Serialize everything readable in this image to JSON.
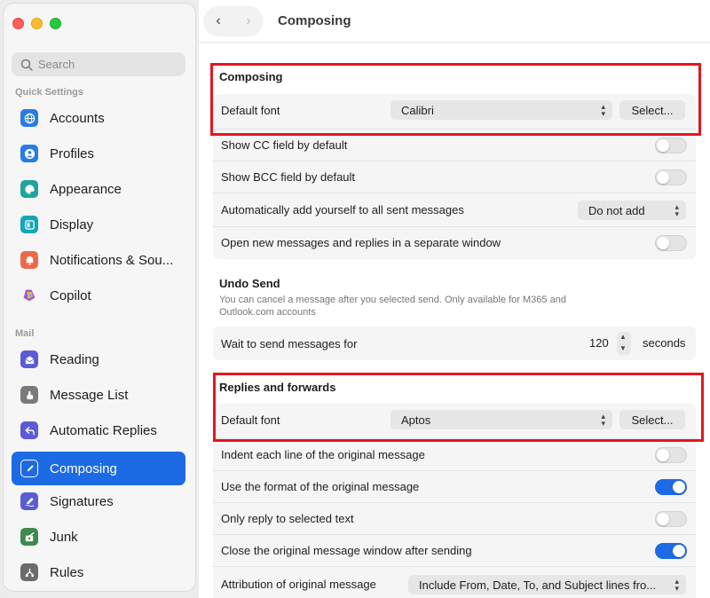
{
  "sidebar": {
    "search_placeholder": "Search",
    "section_quick": "Quick Settings",
    "section_mail": "Mail",
    "items": [
      {
        "label": "Accounts",
        "icon": "globe-icon",
        "color": "#2a7be4"
      },
      {
        "label": "Profiles",
        "icon": "person-icon",
        "color": "#2a7be4"
      },
      {
        "label": "Appearance",
        "icon": "palette-icon",
        "color": "#1fa59a"
      },
      {
        "label": "Display",
        "icon": "display-icon",
        "color": "#14a6b8"
      },
      {
        "label": "Notifications & Sou...",
        "icon": "bell-icon",
        "color": "#ec6a4a"
      },
      {
        "label": "Copilot",
        "icon": "copilot-icon",
        "color": "#a259d9"
      },
      {
        "label": "Reading",
        "icon": "envelope-open-icon",
        "color": "#5b5bd6"
      },
      {
        "label": "Message List",
        "icon": "hand-pointer-icon",
        "color": "#7a7a7a"
      },
      {
        "label": "Automatic Replies",
        "icon": "reply-icon",
        "color": "#5b5bd6"
      },
      {
        "label": "Composing",
        "icon": "compose-icon",
        "color": "#1d6ae5"
      },
      {
        "label": "Signatures",
        "icon": "signature-icon",
        "color": "#5b5bd6"
      },
      {
        "label": "Junk",
        "icon": "junk-icon",
        "color": "#3d8b4f"
      },
      {
        "label": "Rules",
        "icon": "rules-icon",
        "color": "#6b6b6b"
      }
    ]
  },
  "header": {
    "back": "‹",
    "forward": "›",
    "title": "Composing"
  },
  "composing": {
    "title": "Composing",
    "default_font_label": "Default font",
    "default_font_value": "Calibri",
    "select_button": "Select...",
    "show_cc": "Show CC field by default",
    "show_bcc": "Show BCC field by default",
    "auto_add": "Automatically add yourself to all sent messages",
    "auto_add_value": "Do not add",
    "open_new": "Open new messages and replies in a separate window"
  },
  "undo_send": {
    "title": "Undo Send",
    "description": "You can cancel a message after you selected send. Only available for M365 and Outlook.com accounts",
    "wait_label": "Wait to send messages for",
    "wait_value": "120",
    "wait_unit": "seconds"
  },
  "replies": {
    "title": "Replies and forwards",
    "default_font_label": "Default font",
    "default_font_value": "Aptos",
    "select_button": "Select...",
    "indent": "Indent each line of the original message",
    "use_format": "Use the format of the original message",
    "only_reply": "Only reply to selected text",
    "close_window": "Close the original message window after sending",
    "attribution": "Attribution of original message",
    "attribution_value": "Include From, Date, To, and Subject lines fro..."
  },
  "colors": {
    "accent": "#1d6ae5",
    "highlight": "#e5161f"
  }
}
